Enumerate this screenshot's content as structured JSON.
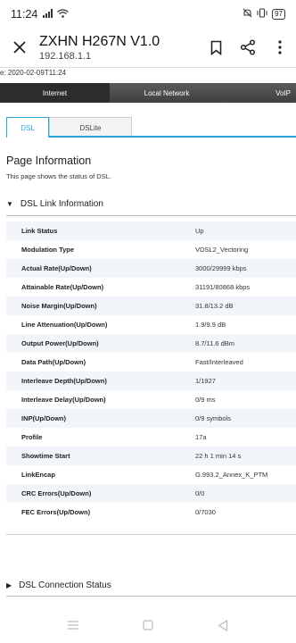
{
  "status_bar": {
    "time": "11:24",
    "battery": "97",
    "icons": [
      "signal-icon",
      "wifi-icon",
      "mute-icon",
      "vibrate-icon",
      "battery-icon"
    ]
  },
  "browser": {
    "title": "ZXHN H267N V1.0",
    "url": "192.168.1.1",
    "actions": [
      "close-icon",
      "bookmark-icon",
      "share-icon",
      "more-icon"
    ]
  },
  "date_line": "e: 2020-02-09T11:24",
  "top_nav": {
    "internet": "Internet",
    "local_network": "Local Network",
    "voip": "VoIP"
  },
  "tabs": {
    "dsl": "DSL",
    "dslite": "DSLite"
  },
  "page": {
    "title": "Page Information",
    "description": "This page shows the status of DSL."
  },
  "section1": {
    "arrow": "▼",
    "title": "DSL Link Information"
  },
  "rows": [
    {
      "label": "Link Status",
      "value": "Up"
    },
    {
      "label": "Modulation Type",
      "value": "VDSL2_Vectoring"
    },
    {
      "label": "Actual Rate(Up/Down)",
      "value": "3000/29999 kbps"
    },
    {
      "label": "Attainable Rate(Up/Down)",
      "value": "31191/80868 kbps"
    },
    {
      "label": "Noise Margin(Up/Down)",
      "value": "31.8/13.2 dB"
    },
    {
      "label": "Line Attenuation(Up/Down)",
      "value": "1.9/9.9 dB"
    },
    {
      "label": "Output Power(Up/Down)",
      "value": "8.7/11.6 dBm"
    },
    {
      "label": "Data Path(Up/Down)",
      "value": "Fast/Interleaved"
    },
    {
      "label": "Interleave Depth(Up/Down)",
      "value": "1/1927"
    },
    {
      "label": "Interleave Delay(Up/Down)",
      "value": "0/9 ms"
    },
    {
      "label": "INP(Up/Down)",
      "value": "0/9 symbols"
    },
    {
      "label": "Profile",
      "value": "17a"
    },
    {
      "label": "Showtime Start",
      "value": "22 h 1 min 14 s"
    },
    {
      "label": "LinkEncap",
      "value": "G.993.2_Annex_K_PTM"
    },
    {
      "label": "CRC Errors(Up/Down)",
      "value": "0/0"
    },
    {
      "label": "FEC Errors(Up/Down)",
      "value": "0/7030"
    }
  ],
  "section2": {
    "arrow": "▶",
    "title": "DSL Connection Status"
  },
  "colors": {
    "accent": "#2aa7d8",
    "nav_dark": "#2c2c2c",
    "row_alt": "#f2f6fa"
  }
}
